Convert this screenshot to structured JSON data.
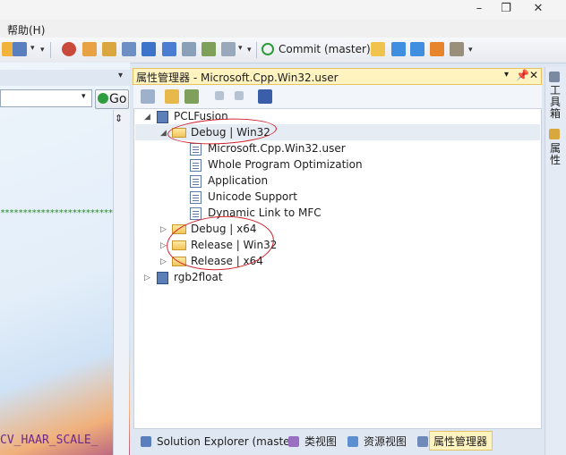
{
  "window": {
    "minimize": "–",
    "restore": "❐",
    "close": "✕"
  },
  "menu": {
    "help": "帮助(H)"
  },
  "toolbar": {
    "commit_label": "Commit (master)"
  },
  "editor": {
    "go_label": "Go",
    "stars": "************************************",
    "code_text": "CV_HAAR_SCALE_"
  },
  "property_manager": {
    "title": "属性管理器 - Microsoft.Cpp.Win32.user",
    "pin": "ᵦ",
    "close": "✕",
    "tree": [
      {
        "label": "PCLFusion",
        "icon": "project-icon",
        "expander": "◢"
      },
      {
        "label": "Debug | Win32",
        "icon": "folder-open-icon",
        "expander": "◢"
      },
      {
        "label": "Microsoft.Cpp.Win32.user",
        "icon": "property-sheet-icon"
      },
      {
        "label": "Whole Program Optimization",
        "icon": "property-sheet-icon"
      },
      {
        "label": "Application",
        "icon": "property-sheet-icon"
      },
      {
        "label": "Unicode Support",
        "icon": "property-sheet-icon"
      },
      {
        "label": "Dynamic Link to MFC",
        "icon": "property-sheet-icon"
      },
      {
        "label": "Debug | x64",
        "icon": "folder-icon",
        "expander": "▷"
      },
      {
        "label": "Release | Win32",
        "icon": "folder-icon",
        "expander": "▷"
      },
      {
        "label": "Release | x64",
        "icon": "folder-icon",
        "expander": "▷"
      },
      {
        "label": "rgb2float",
        "icon": "project-icon",
        "expander": "▷"
      }
    ]
  },
  "bottom_tabs": [
    {
      "label": "Solution Explorer (master)"
    },
    {
      "label": "类视图"
    },
    {
      "label": "资源视图"
    },
    {
      "label": "属性管理器",
      "active": true
    }
  ],
  "right_strip": {
    "toolbox": "工具箱",
    "properties": "属性"
  },
  "colors": {
    "accent_tab": "#fff3c0",
    "annotation": "#d0242f",
    "commit": "#2e9b3b"
  }
}
